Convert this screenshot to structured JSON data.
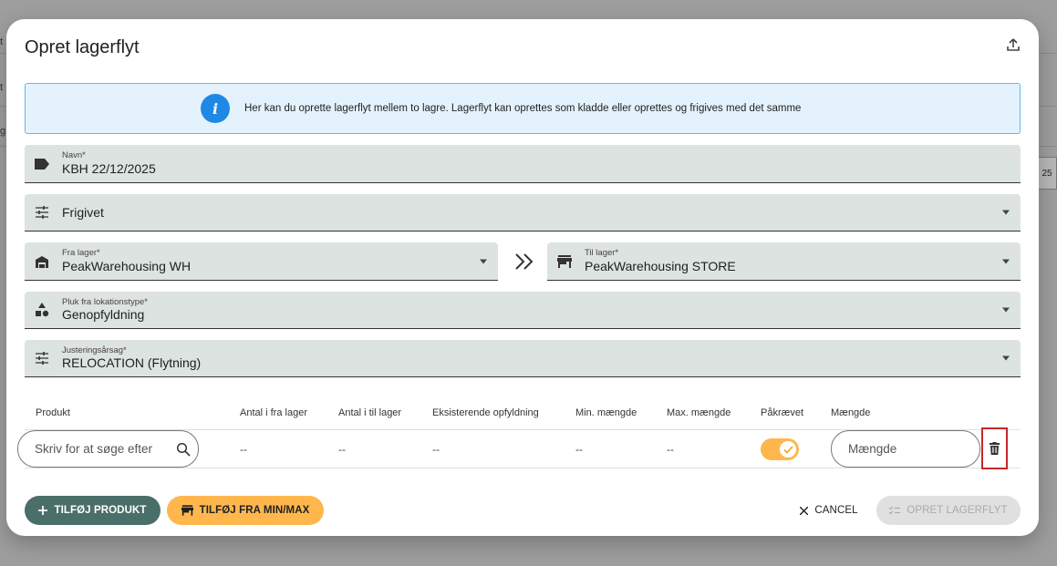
{
  "background": {
    "fragments": [
      "t",
      "t",
      "g",
      "25"
    ]
  },
  "dialog": {
    "title": "Opret lagerflyt",
    "info_text": "Her kan du oprette lagerflyt mellem to lagre. Lagerflyt kan oprettes som kladde eller oprettes og frigives med det samme",
    "fields": {
      "name": {
        "label": "Navn*",
        "value": "KBH 22/12/2025"
      },
      "status": {
        "value": "Frigivet"
      },
      "from_warehouse": {
        "label": "Fra lager*",
        "value": "PeakWarehousing WH"
      },
      "to_warehouse": {
        "label": "Til lager*",
        "value": "PeakWarehousing STORE"
      },
      "pick_location_type": {
        "label": "Pluk fra lokationstype*",
        "value": "Genopfyldning"
      },
      "adjustment_reason": {
        "label": "Justeringsårsag*",
        "value": "RELOCATION (Flytning)"
      }
    },
    "table": {
      "headers": [
        "Produkt",
        "Antal i fra lager",
        "Antal i til lager",
        "Eksisterende opfyldning",
        "Min. mængde",
        "Max. mængde",
        "Påkrævet",
        "Mængde"
      ],
      "row": {
        "search_placeholder": "Skriv for at søge efter",
        "qty_from": "--",
        "qty_to": "--",
        "existing": "--",
        "min": "--",
        "max": "--",
        "required": true,
        "quantity_placeholder": "Mængde"
      }
    },
    "buttons": {
      "add_product": "TILFØJ PRODUKT",
      "add_from_minmax": "TILFØJ FRA MIN/MAX",
      "cancel": "CANCEL",
      "create": "OPRET LAGERFLYT"
    }
  },
  "colors": {
    "primary": "#4a6e6a",
    "accent": "#ffb74d",
    "field_bg": "#dce3e1",
    "info_bg": "#e3f2fd",
    "info_icon": "#1e88e5",
    "highlight": "#c62828"
  }
}
